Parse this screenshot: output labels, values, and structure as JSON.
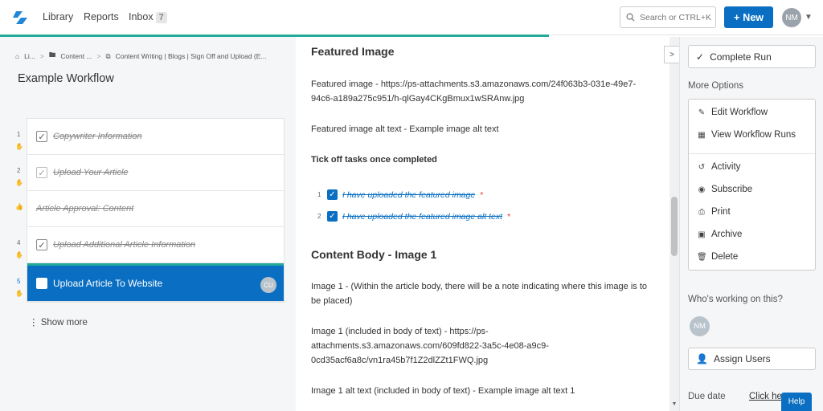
{
  "nav": {
    "library": "Library",
    "reports": "Reports",
    "inbox": "Inbox",
    "inbox_count": "7",
    "search_placeholder": "Search or CTRL+K",
    "new_label": "New",
    "user_initials": "NM"
  },
  "progress_fraction": 0.667,
  "breadcrumb": {
    "item1": "Li...",
    "item2": "Content ...",
    "item3": "Content Writing | Blogs | Sign Off and Upload (E..."
  },
  "workflow_title": "Example Workflow",
  "tasks": [
    {
      "num": "1",
      "label": "Copywriter Information",
      "checked": true
    },
    {
      "num": "2",
      "label": "Upload Your Article",
      "checked": true
    },
    {
      "num": "",
      "label": "Article Approval: Content",
      "checked": false
    },
    {
      "num": "4",
      "label": "Upload Additional Article Information",
      "checked": true
    },
    {
      "num": "5",
      "label": "Upload Article To Website",
      "assignee": "CU"
    }
  ],
  "show_more": "Show more",
  "content": {
    "featured_heading": "Featured Image",
    "featured_url": "Featured image - https://ps-attachments.s3.amazonaws.com/24f063b3-031e-49e7-94c6-a189a275c951/h-qlGay4CKgBmux1wSRAnw.jpg",
    "featured_alt": "Featured image alt text - Example image alt text",
    "tick_off": "Tick off tasks once completed",
    "subtasks": [
      {
        "num": "1",
        "label": "I have uploaded the featured image"
      },
      {
        "num": "2",
        "label": "I have uploaded the featured image alt text"
      }
    ],
    "required_mark": "*",
    "body_heading": "Content Body - Image 1",
    "image1_note": "Image 1 - (Within the article body, there will be a note indicating where this image is to be placed)",
    "image1_url": "Image 1 (included in body of text) - https://ps-attachments.s3.amazonaws.com/609fd822-3a5c-4e08-a9c9-0cd35acf6a8c/vn1ra45b7f1Z2dlZZt1FWQ.jpg",
    "image1_alt": "Image 1 alt text (included in body of text) - Example image alt text 1"
  },
  "sidebar": {
    "complete_run": "Complete Run",
    "more_options": "More Options",
    "edit_workflow": "Edit Workflow",
    "view_runs": "View Workflow Runs",
    "activity": "Activity",
    "subscribe": "Subscribe",
    "print": "Print",
    "archive": "Archive",
    "delete": "Delete",
    "working_label": "Who's working on this?",
    "working_initials": "NM",
    "assign_users": "Assign Users",
    "due_date": "Due date",
    "click_here": "Click he"
  },
  "help": "Help",
  "colors": {
    "primary": "#0a6fc2",
    "progress": "#22a99a"
  }
}
